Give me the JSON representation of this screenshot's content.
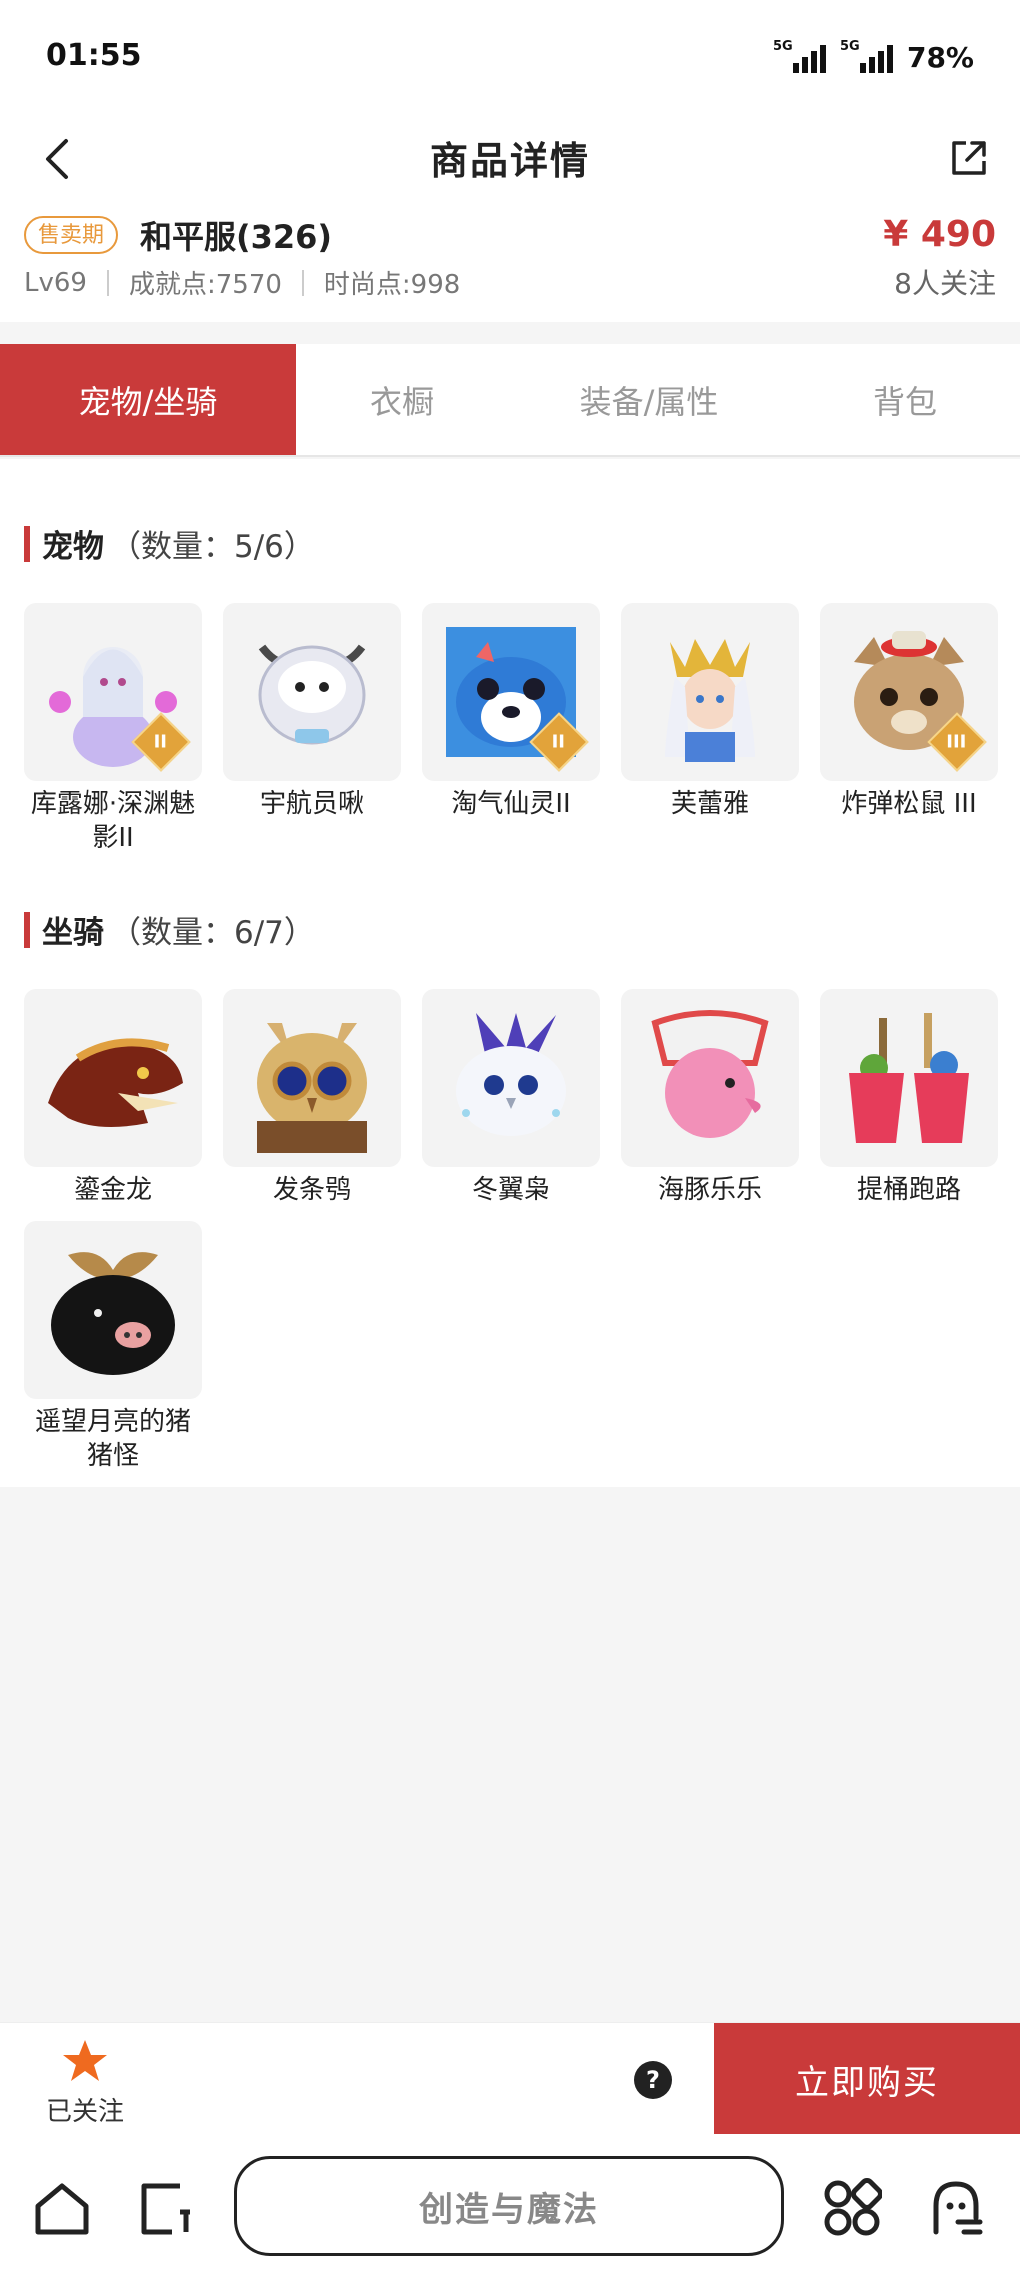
{
  "status_bar": {
    "time": "01:55",
    "network1": "5G",
    "network2": "5G",
    "battery": "78%"
  },
  "nav": {
    "title": "商品详情",
    "back_icon": "chevron-left-icon",
    "share_icon": "share-icon"
  },
  "product": {
    "badge": "售卖期",
    "server": "和平服(326)",
    "level": "Lv69",
    "achievement": "成就点:7570",
    "fashion": "时尚点:998",
    "price": "¥ 490",
    "followers": "8人关注"
  },
  "tabs": [
    {
      "label": "宠物/坐骑",
      "active": true
    },
    {
      "label": "衣橱",
      "active": false
    },
    {
      "label": "装备/属性",
      "active": false
    },
    {
      "label": "背包",
      "active": false
    }
  ],
  "pets": {
    "title": "宠物",
    "count": "（数量：5/6）",
    "items": [
      {
        "name": "库露娜·深渊魅影II",
        "tier": "II"
      },
      {
        "name": "宇航员啾",
        "tier": ""
      },
      {
        "name": "淘气仙灵II",
        "tier": "II"
      },
      {
        "name": "芙蕾雅",
        "tier": ""
      },
      {
        "name": "炸弹松鼠 III",
        "tier": "III"
      }
    ]
  },
  "mounts": {
    "title": "坐骑",
    "count": "（数量：6/7）",
    "items": [
      {
        "name": "鎏金龙"
      },
      {
        "name": "发条鸮"
      },
      {
        "name": "冬翼枭"
      },
      {
        "name": "海豚乐乐"
      },
      {
        "name": "提桶跑路"
      },
      {
        "name": "遥望月亮的猪猪怪"
      }
    ]
  },
  "action_bar": {
    "follow_label": "已关注",
    "help": "?",
    "buy_label": "立即购买"
  },
  "bottom_bar": {
    "center_label": "创造与魔法"
  },
  "colors": {
    "accent": "#c93a3a",
    "badge": "#e8993c",
    "follow_star": "#ef6a1f"
  }
}
